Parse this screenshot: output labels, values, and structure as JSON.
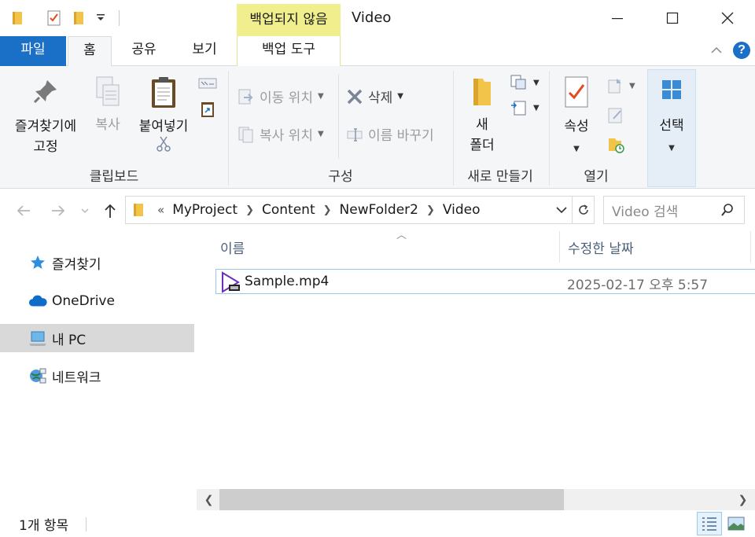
{
  "titlebar": {
    "context_label": "백업되지 않음",
    "window_title": "Video"
  },
  "tabs": {
    "file": "파일",
    "home": "홈",
    "share": "공유",
    "view": "보기",
    "backup_tools": "백업 도구"
  },
  "ribbon": {
    "clipboard": {
      "group_label": "클립보드",
      "pin_line1": "즐겨찾기에",
      "pin_line2": "고정",
      "copy": "복사",
      "paste": "붙여넣기"
    },
    "organize": {
      "group_label": "구성",
      "move_to": "이동 위치",
      "copy_to": "복사 위치",
      "delete": "삭제",
      "rename": "이름 바꾸기"
    },
    "new": {
      "group_label": "새로 만들기",
      "new_folder_line1": "새",
      "new_folder_line2": "폴더"
    },
    "open": {
      "group_label": "열기",
      "properties": "속성"
    },
    "select": {
      "label": "선택"
    }
  },
  "address": {
    "overflow": "«",
    "crumbs": [
      "MyProject",
      "Content",
      "NewFolder2",
      "Video"
    ],
    "search_placeholder": "Video 검색"
  },
  "navpane": {
    "items": [
      {
        "label": "즐겨찾기",
        "icon": "star-icon"
      },
      {
        "label": "OneDrive",
        "icon": "cloud-icon"
      },
      {
        "label": "내 PC",
        "icon": "computer-icon"
      },
      {
        "label": "네트워크",
        "icon": "network-icon"
      }
    ],
    "selected_index": 2
  },
  "filelist": {
    "columns": [
      "이름",
      "수정한 날짜"
    ],
    "files": [
      {
        "name": "Sample.mp4",
        "modified": "2025-02-17 오후 5:57",
        "icon": "video-file-icon"
      }
    ]
  },
  "status": {
    "item_count": "1개 항목"
  },
  "colors": {
    "accent": "#1a6fc7",
    "context_tab": "#f1ee8e",
    "selection_border": "#99c9ef",
    "ribbon_bg": "#f5f6f7"
  }
}
